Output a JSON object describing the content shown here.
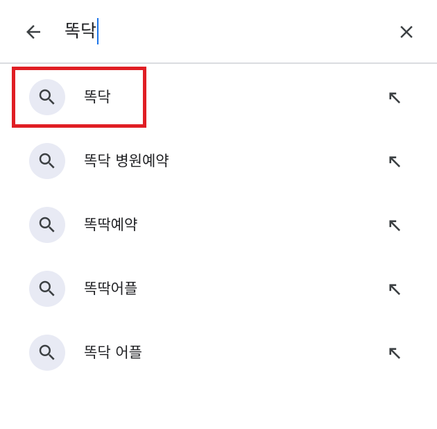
{
  "search": {
    "query": "똑닥",
    "back_icon": "arrow-back-icon",
    "clear_icon": "close-icon"
  },
  "suggestions": [
    {
      "label": "똑닥",
      "icon": "search-icon",
      "action_icon": "arrow-up-left-icon"
    },
    {
      "label": "똑닥 병원예약",
      "icon": "search-icon",
      "action_icon": "arrow-up-left-icon"
    },
    {
      "label": "똑딱예약",
      "icon": "search-icon",
      "action_icon": "arrow-up-left-icon"
    },
    {
      "label": "똑딱어플",
      "icon": "search-icon",
      "action_icon": "arrow-up-left-icon"
    },
    {
      "label": "똑닥 어플",
      "icon": "search-icon",
      "action_icon": "arrow-up-left-icon"
    }
  ],
  "colors": {
    "highlight_box": "#e01e24",
    "caret": "#1a73e8",
    "icon_circle": "#e8eaf4",
    "divider": "#dadce0"
  }
}
